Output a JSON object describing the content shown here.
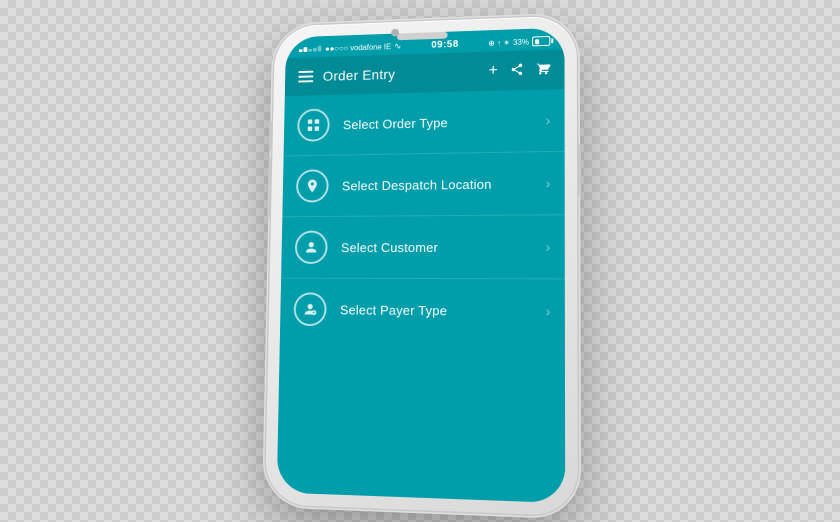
{
  "phone": {
    "status_bar": {
      "carrier": "●●○○○ vodafone IE",
      "wifi": "wifi",
      "time": "09:58",
      "icons_right": "⊕ ↑ ✶",
      "battery_pct": "33%"
    },
    "header": {
      "title": "Order Entry",
      "add_label": "+",
      "share_label": "⬆",
      "cart_label": "🛒"
    },
    "menu_items": [
      {
        "label": "Select Order Type",
        "icon_type": "grid"
      },
      {
        "label": "Select Despatch Location",
        "icon_type": "pin"
      },
      {
        "label": "Select Customer",
        "icon_type": "person"
      },
      {
        "label": "Select Payer Type",
        "icon_type": "person-badge"
      }
    ]
  }
}
